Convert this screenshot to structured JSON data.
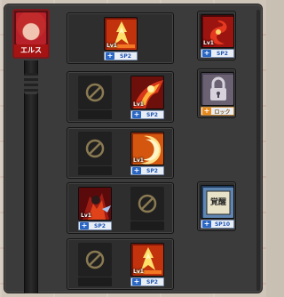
{
  "character": {
    "name": "エルス",
    "portrait_color": "#b8202a"
  },
  "rows": [
    {
      "cells": [
        {
          "type": "skill",
          "level": "Lv1",
          "sp": "SP2",
          "art": "fire-pillar"
        }
      ]
    },
    {
      "cells": [
        {
          "type": "locked"
        },
        {
          "type": "skill",
          "level": "Lv1",
          "sp": "SP2",
          "art": "phoenix-strike"
        }
      ]
    },
    {
      "cells": [
        {
          "type": "locked"
        },
        {
          "type": "skill",
          "level": "Lv1",
          "sp": "SP2",
          "art": "crescent-slash"
        }
      ]
    },
    {
      "cells": [
        {
          "type": "skill",
          "level": "Lv1",
          "sp": "SP2",
          "art": "flame-knight"
        },
        {
          "type": "locked"
        }
      ]
    },
    {
      "cells": [
        {
          "type": "locked"
        },
        {
          "type": "skill",
          "level": "Lv1",
          "sp": "SP2",
          "art": "fire-pillar"
        }
      ]
    }
  ],
  "right_column": [
    {
      "type": "skill",
      "level": "Lv1",
      "sp": "SP2",
      "art": "fire-vortex"
    },
    {
      "type": "locked-skill",
      "sp": "ロック",
      "art": "padlock"
    },
    {
      "type": "skill",
      "level": "",
      "sp": "SP10",
      "art": "awakening-seal",
      "seal_text": "覚醒"
    }
  ],
  "colors": {
    "sp_blue": "#2a66c4",
    "lock_orange": "#e68a1e",
    "panel": "#3b3b3b"
  }
}
